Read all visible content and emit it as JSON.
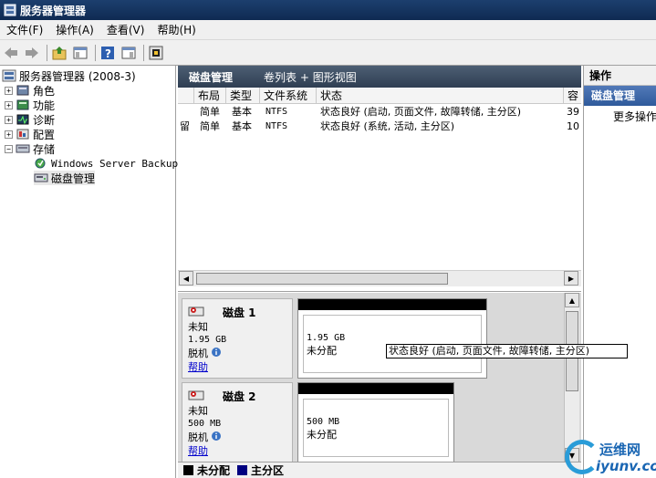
{
  "window": {
    "title": "服务器管理器"
  },
  "menu": [
    "文件(F)",
    "操作(A)",
    "查看(V)",
    "帮助(H)"
  ],
  "tree": {
    "root": "服务器管理器 (2008-3)",
    "items": [
      "角色",
      "功能",
      "诊断",
      "配置",
      "存储"
    ],
    "storage_children": [
      "Windows Server Backup",
      "磁盘管理"
    ]
  },
  "center": {
    "title": "磁盘管理",
    "view_label": "卷列表 + 图形视图"
  },
  "volume_list": {
    "headers": [
      "布局",
      "类型",
      "文件系统",
      "状态",
      "容"
    ],
    "rows": [
      {
        "name": "",
        "layout": "简单",
        "type": "基本",
        "fs": "NTFS",
        "status": "状态良好 (启动, 页面文件, 故障转储, 主分区)",
        "capacity": "39"
      },
      {
        "name": "留",
        "layout": "简单",
        "type": "基本",
        "fs": "NTFS",
        "status": "状态良好 (系统, 活动, 主分区)",
        "capacity": "10"
      }
    ]
  },
  "disks": [
    {
      "name": "磁盘 1",
      "type": "未知",
      "size": "1.95 GB",
      "state": "脱机",
      "help": "帮助",
      "part_size": "1.95 GB",
      "part_status": "未分配"
    },
    {
      "name": "磁盘 2",
      "type": "未知",
      "size": "500 MB",
      "state": "脱机",
      "help": "帮助",
      "part_size": "500 MB",
      "part_status": "未分配"
    }
  ],
  "tooltip": "状态良好 (启动, 页面文件, 故障转储, 主分区)",
  "legend": [
    {
      "label": "未分配",
      "color": "#000000"
    },
    {
      "label": "主分区",
      "color": "#000080"
    }
  ],
  "actions": {
    "header": "操作",
    "section": "磁盘管理",
    "more": "更多操作"
  },
  "watermark": {
    "text1": "运维网",
    "text2": "iyunv.com"
  },
  "colors": {
    "title_bar": "#1c3f6e",
    "center_header": "#3d4d63",
    "action_section": "#3f69aa",
    "link": "#0000cc"
  }
}
